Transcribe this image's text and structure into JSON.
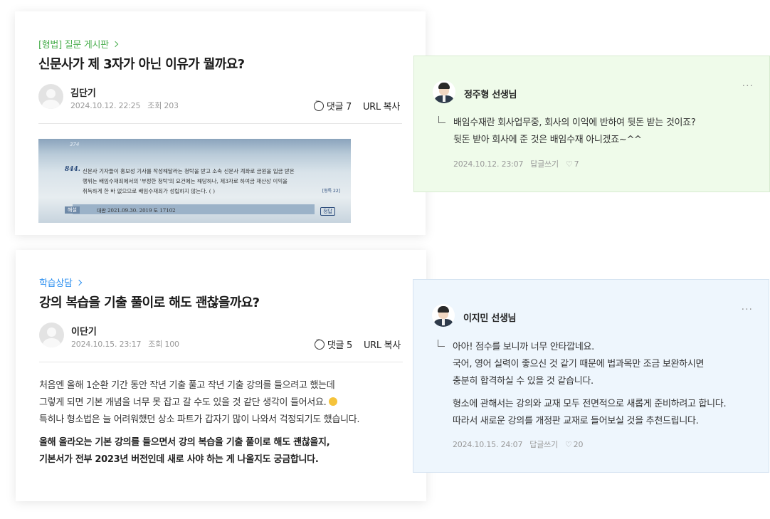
{
  "post1": {
    "board": "[형법] 질문 게시판",
    "title": "신문사가 제 3자가 아닌 이유가 뭘까요?",
    "author": "김단기",
    "date": "2024.10.12. 22:25",
    "views": "조회 203",
    "comments": "댓글 7",
    "copy_url": "URL 복사",
    "image": {
      "page_number": "374",
      "question_number": "844.",
      "lines": [
        "신문사 기자들이 홍보성 기사를 작성해달라는 청탁을 받고 소속 신문사 계좌로 금원을 입금 받은",
        "행위는 배임수재죄에서의 '부정한 청탁'의 요건에는 해당하나, 제3자로 하여금 재산상 이익을",
        "취득하게 한 바 없으므로 배임수재죄가 성립하지 않는다. (      )"
      ],
      "tag": "[형특 22]",
      "hint_label": "해설",
      "hint_text": "대판 2021.09.30. 2019 도 17102",
      "answer": "정답"
    }
  },
  "post2": {
    "board": "학습상담",
    "title": "강의 복습을 기출 풀이로 해도 괜찮을까요?",
    "author": "이단기",
    "date": "2024.10.15. 23:17",
    "views": "조회 100",
    "comments": "댓글 5",
    "copy_url": "URL 복사",
    "body": [
      "처음엔 올해 1순환 기간 동안 작년 기출 풀고 작년 기출 강의를 들으려고 했는데",
      "그렇게 되면 기본 개념을 너무 못 잡고 갈 수도 있을 것 같단 생각이 들어서요.",
      "특히나 형소법은 늘 어려워했던 상소 파트가 갑자기 많이 나와서 걱정되기도 했습니다."
    ],
    "body_bold": [
      "올해 올라오는 기본 강의를 들으면서 강의 복습을 기출 풀이로 해도 괜찮을지,",
      "기본서가 전부 2023년 버전인데 새로 사야 하는 게 나올지도 궁금합니다."
    ]
  },
  "reply1": {
    "teacher": "정주형 선생님",
    "lines": [
      "배임수재란 회사업무중, 회사의 이익에 반하여 뒷돈 받는 것이죠?",
      "뒷돈 받아 회사에 준 것은 배임수재 아니겠죠~^^"
    ],
    "date": "2024.10.12.  23:07",
    "reply_label": "답글쓰기",
    "likes": "7"
  },
  "reply2": {
    "teacher": "이지민 선생님",
    "lines": [
      "아아! 점수를 보니까 너무 안타깝네요.",
      "국어, 영어 실력이 좋으신 것 같기 때문에 법과목만 조금 보완하시면",
      "충분히 합격하실 수 있을 것 같습니다."
    ],
    "lines2": [
      "형소에 관해서는 강의와 교재 모두 전면적으로 새롭게 준비하려고 합니다.",
      "따라서 새로운 강의를 개정판 교재로 들어보실 것을 추천드립니다."
    ],
    "date": "2024.10.15.  24:07",
    "reply_label": "답글쓰기",
    "likes": "20"
  },
  "colors": {
    "green_board": "#4caf50",
    "blue_board": "#2b8ff0",
    "reply_green_bg": "#effbea",
    "reply_blue_bg": "#eef6fd"
  }
}
